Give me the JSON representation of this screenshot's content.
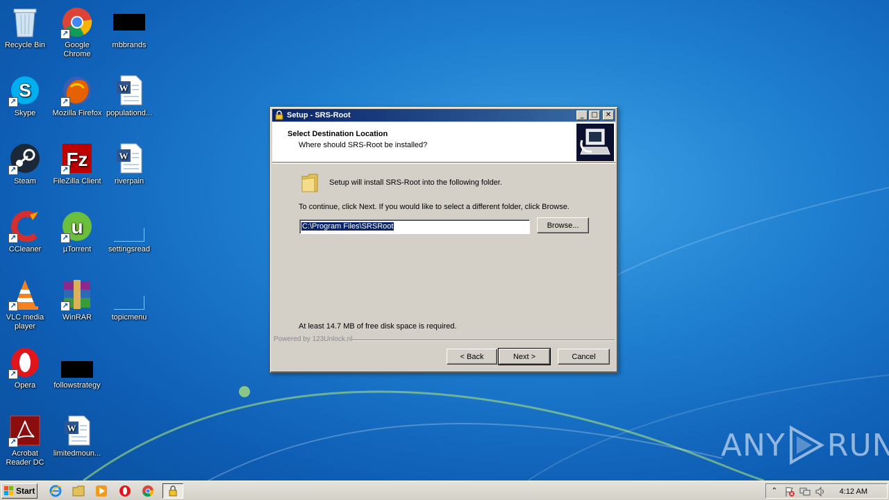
{
  "desktop": {
    "icons": [
      {
        "label": "Recycle Bin",
        "icon": "recycle-bin-icon"
      },
      {
        "label": "Google Chrome",
        "icon": "chrome-icon"
      },
      {
        "label": "mbbrands",
        "icon": "black-file-icon"
      },
      {
        "label": "Skype",
        "icon": "skype-icon"
      },
      {
        "label": "Mozilla Firefox",
        "icon": "firefox-icon"
      },
      {
        "label": "populationd...",
        "icon": "word-doc-icon"
      },
      {
        "label": "Steam",
        "icon": "steam-icon"
      },
      {
        "label": "FileZilla Client",
        "icon": "filezilla-icon"
      },
      {
        "label": "riverpain",
        "icon": "word-doc-icon"
      },
      {
        "label": "CCleaner",
        "icon": "ccleaner-icon"
      },
      {
        "label": "µTorrent",
        "icon": "utorrent-icon"
      },
      {
        "label": "settingsread",
        "icon": "blank-file-icon"
      },
      {
        "label": "VLC media player",
        "icon": "vlc-icon"
      },
      {
        "label": "WinRAR",
        "icon": "winrar-icon"
      },
      {
        "label": "topicmenu",
        "icon": "blank-file-icon"
      },
      {
        "label": "Opera",
        "icon": "opera-icon"
      },
      {
        "label": "followstrategy",
        "icon": "black-file-icon"
      },
      {
        "label": "Acrobat Reader DC",
        "icon": "acrobat-icon"
      },
      {
        "label": "limitedmoun...",
        "icon": "word-doc-icon"
      }
    ]
  },
  "window": {
    "title": "Setup - SRS-Root",
    "header_title": "Select Destination Location",
    "header_subtitle": "Where should SRS-Root be installed?",
    "install_msg": "Setup will install SRS-Root into the following folder.",
    "continue_msg": "To continue, click Next. If you would like to select a different folder, click Browse.",
    "path_value": "C:\\Program Files\\SRSRoot",
    "browse_label": "Browse...",
    "disk_space_msg": "At least 14.7 MB of free disk space is required.",
    "powered_by": "Powered by 123Unlock.nl",
    "back_label": "< Back",
    "next_label": "Next >",
    "cancel_label": "Cancel"
  },
  "taskbar": {
    "start_label": "Start",
    "clock": "4:12 AM"
  },
  "watermark": {
    "left": "ANY",
    "right": "RUN"
  },
  "colors": {
    "titlebar_start": "#0a246a",
    "titlebar_end": "#3a6ea5",
    "dialog_bg": "#d4d0c8",
    "selection": "#0a246a"
  }
}
